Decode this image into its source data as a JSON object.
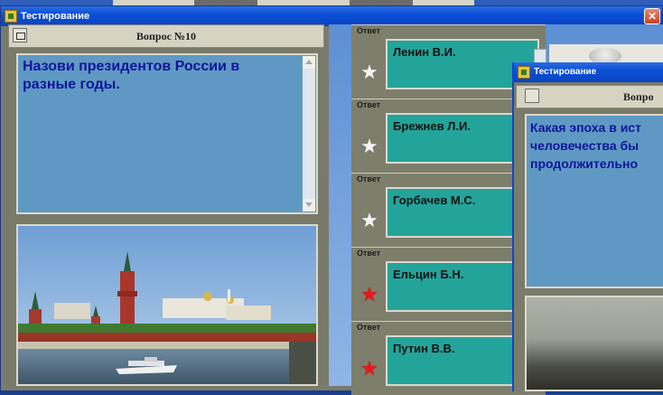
{
  "background": {
    "accent": "#1b3f8f"
  },
  "window": {
    "title": "Тестирование",
    "close_glyph": "✕"
  },
  "question": {
    "header": "Вопрос №10",
    "text": "Назови президентов России в разные годы.",
    "text_color": "#10169b",
    "box_color": "#5f99c3"
  },
  "answers": {
    "label": "Ответ",
    "items": [
      {
        "text": "Ленин В.И.",
        "star": "white"
      },
      {
        "text": "Брежнев Л.И.",
        "star": "white"
      },
      {
        "text": "Горбачев М.С.",
        "star": "white"
      },
      {
        "text": "Ельцин Б.Н.",
        "star": "red"
      },
      {
        "text": "Путин В.В.",
        "star": "red"
      }
    ],
    "box_color": "#23a49a"
  },
  "window2": {
    "title": "Тестирование",
    "header": "Вопро",
    "text_lines": [
      "Какая эпоха в ист",
      "человечества бы",
      "продолжительно"
    ]
  }
}
